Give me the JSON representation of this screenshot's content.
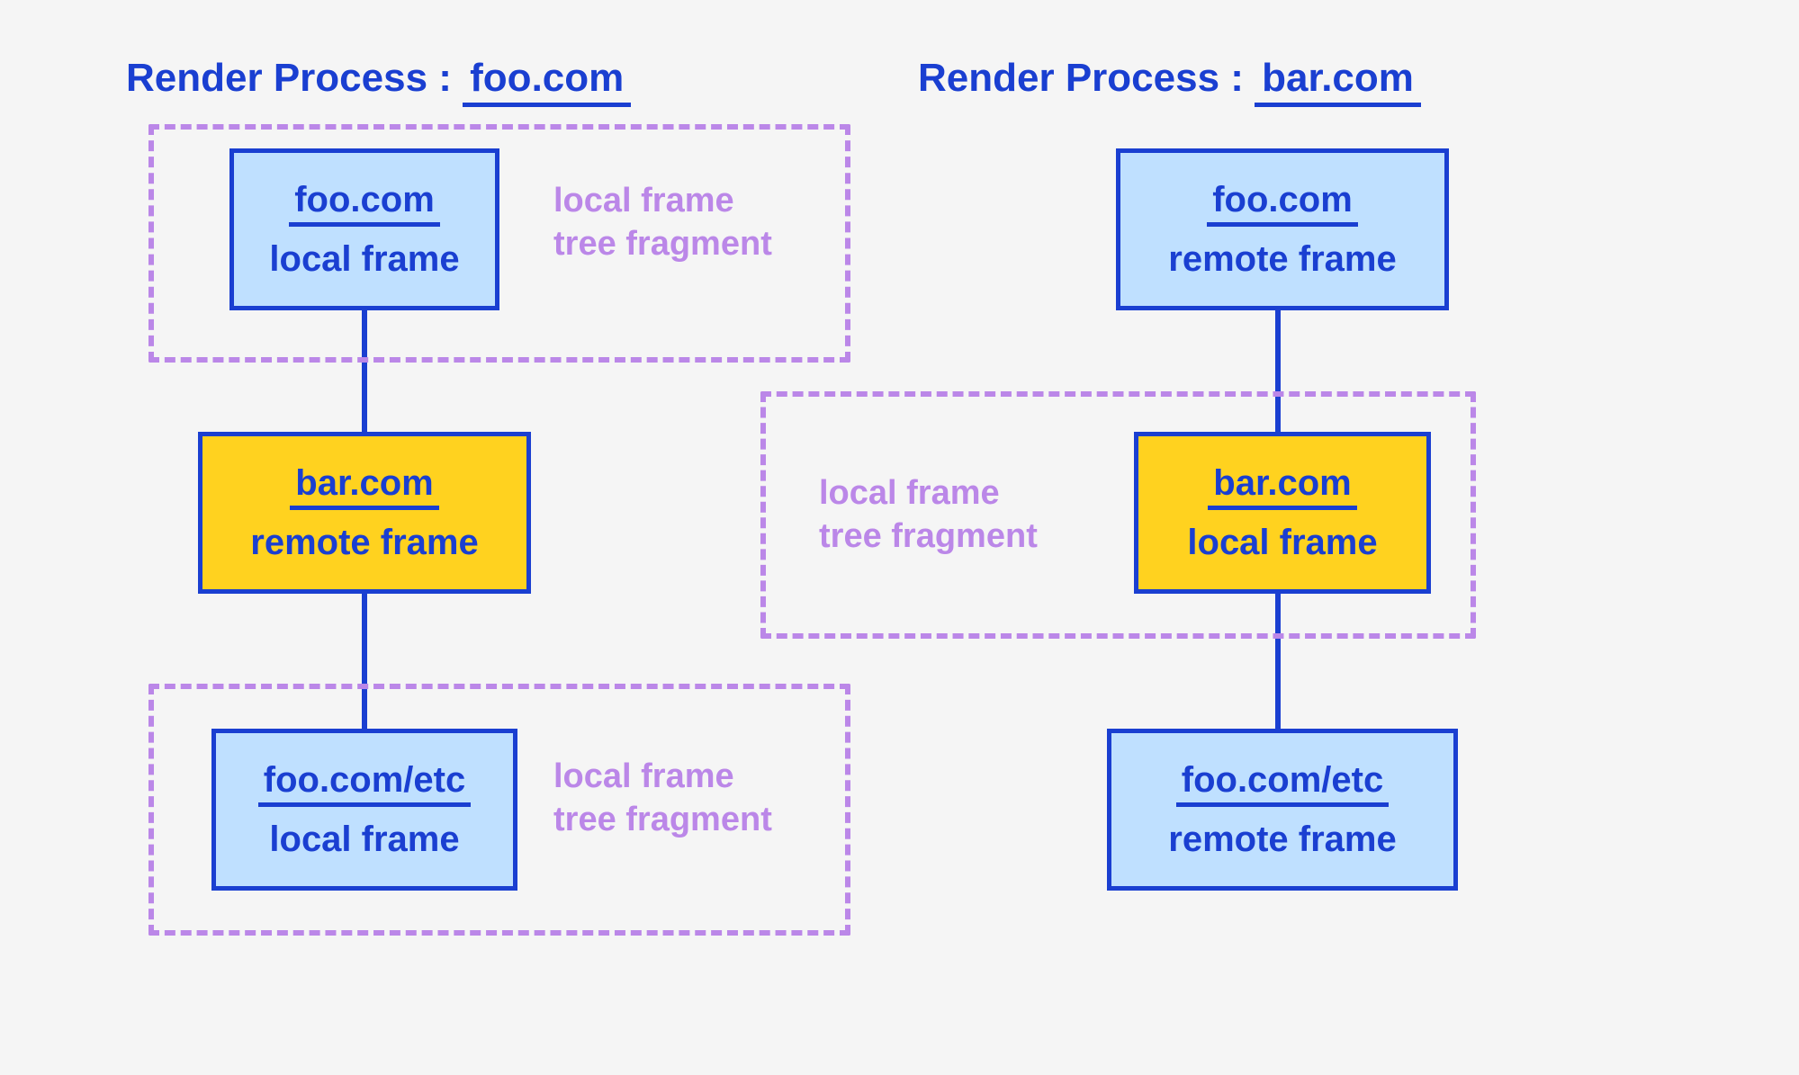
{
  "colors": {
    "stroke_blue": "#1a3fd1",
    "fill_blue": "#bfe0ff",
    "fill_yellow": "#ffd21f",
    "dash_purple": "#bb87e8",
    "highlight_blue": "#9fd2ff",
    "highlight_yellow": "#ffd21f"
  },
  "left": {
    "heading_prefix": "Render Process : ",
    "heading_site": "foo.com",
    "nodes": [
      {
        "domain": "foo.com",
        "type": "local frame"
      },
      {
        "domain": "bar.com",
        "type": "remote frame"
      },
      {
        "domain": "foo.com/etc",
        "type": "local frame"
      }
    ],
    "fragment_label_line1": "local frame",
    "fragment_label_line2": "tree fragment"
  },
  "right": {
    "heading_prefix": "Render Process : ",
    "heading_site": "bar.com",
    "nodes": [
      {
        "domain": "foo.com",
        "type": "remote frame"
      },
      {
        "domain": "bar.com",
        "type": "local frame"
      },
      {
        "domain": "foo.com/etc",
        "type": "remote frame"
      }
    ],
    "fragment_label_line1": "local frame",
    "fragment_label_line2": "tree fragment"
  }
}
